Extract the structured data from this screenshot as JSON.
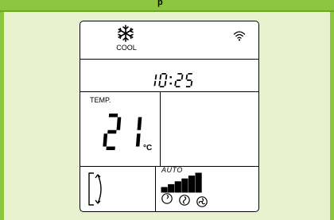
{
  "header": {
    "title_fragment": "p"
  },
  "display": {
    "mode": "COOL",
    "mode_icon": "snowflake-icon",
    "wifi_icon": "wifi-icon",
    "time": "10:25",
    "temp_title": "TEMP.",
    "temperature": "21",
    "temperature_unit": "°C",
    "swing_icon": "swing-icon",
    "fan_mode": "AUTO",
    "fan_level": 1.0,
    "fan_speed_icons": [
      "fan-low-icon",
      "fan-mid-icon",
      "fan-high-icon"
    ]
  },
  "colors": {
    "accent": "#8cc63f",
    "background": "#e9f2cf",
    "segment": "#000000"
  }
}
